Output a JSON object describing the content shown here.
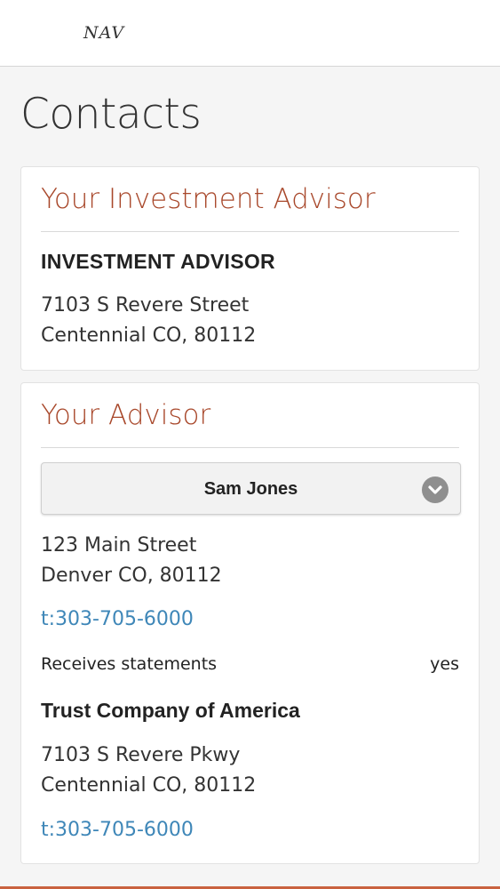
{
  "header": {
    "logo_text": "NAV"
  },
  "page": {
    "title": "Contacts"
  },
  "investment_advisor_card": {
    "heading": "Your Investment Advisor",
    "firm_name": "INVESTMENT ADVISOR",
    "address_line1": "7103 S Revere Street",
    "address_line2": "Centennial CO, 80112"
  },
  "advisor_card": {
    "heading": "Your Advisor",
    "advisor_select": {
      "selected_value": "Sam Jones",
      "icon": "chevron-down-icon"
    },
    "address_line1": "123 Main Street",
    "address_line2": "Denver CO, 80112",
    "phone": "t:303-705-6000",
    "statements_label": "Receives statements",
    "statements_value": "yes",
    "custodian": {
      "name": "Trust Company of America",
      "address_line1": "7103 S Revere Pkwy",
      "address_line2": "Centennial CO, 80112",
      "phone": "t:303-705-6000"
    }
  },
  "colors": {
    "heading_accent": "#a8472a",
    "link": "#3f87b8",
    "bottom_accent": "#c9623f"
  }
}
